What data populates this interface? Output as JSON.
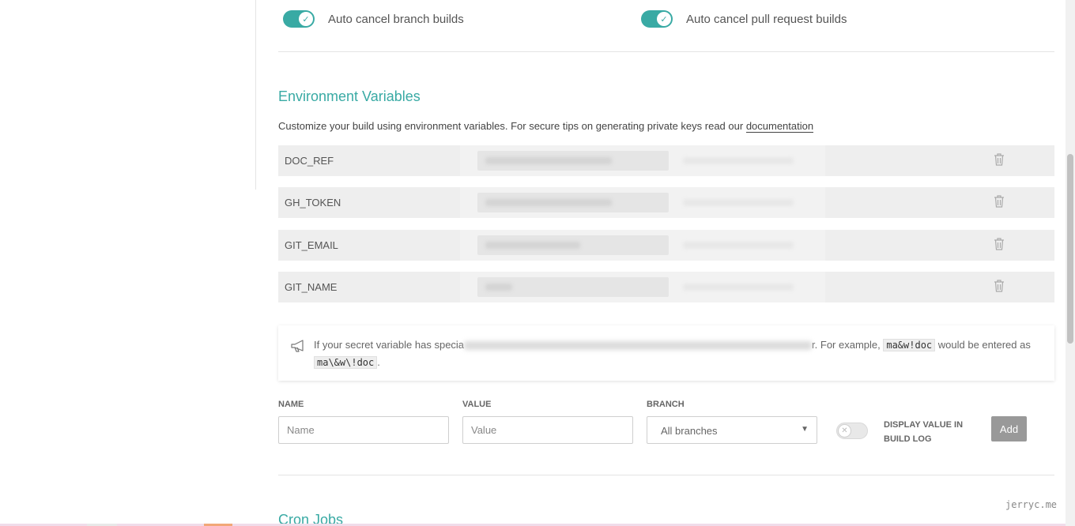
{
  "settings": {
    "auto_cancel_branch": {
      "label": "Auto cancel branch builds",
      "enabled": true
    },
    "auto_cancel_pr": {
      "label": "Auto cancel pull request builds",
      "enabled": true
    }
  },
  "env_section": {
    "title": "Environment Variables",
    "description_pre": "Customize your build using environment variables. For secure tips on generating private keys read our ",
    "description_link": "documentation",
    "rows": [
      {
        "name": "DOC_REF"
      },
      {
        "name": "GH_TOKEN"
      },
      {
        "name": "GIT_EMAIL"
      },
      {
        "name": "GIT_NAME"
      }
    ],
    "notice": {
      "text_pre": "If your secret variable has specia",
      "text_mid": "r. For example, ",
      "example_code": "ma&w!doc",
      "text_between": " would be entered as ",
      "escaped_code": "ma\\&w\\!doc",
      "text_end": "."
    },
    "form": {
      "name_label": "NAME",
      "name_placeholder": "Name",
      "value_label": "VALUE",
      "value_placeholder": "Value",
      "branch_label": "BRANCH",
      "branch_selected": "All branches",
      "display_toggle_label": "DISPLAY VALUE IN BUILD LOG",
      "add_label": "Add"
    }
  },
  "cron_section": {
    "title": "Cron Jobs"
  },
  "watermark": "jerryc.me",
  "colors": {
    "accent": "#39aaa4",
    "row_bg": "#eeeeee",
    "button_disabled": "#999999"
  }
}
